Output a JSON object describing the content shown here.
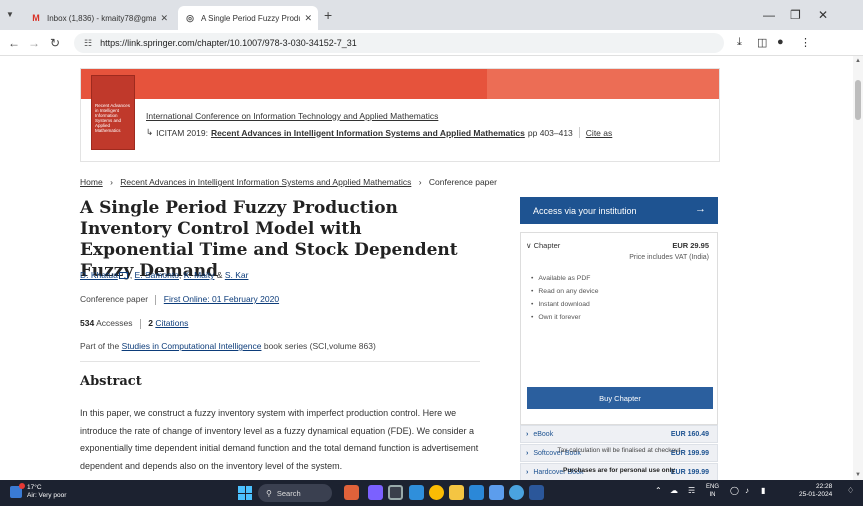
{
  "browser": {
    "tabs": [
      {
        "label": "Inbox (1,836) - kmaity78@gma...",
        "icon": "gmail-icon",
        "active": false
      },
      {
        "label": "A Single Period Fuzzy Productio",
        "icon": "springer-icon",
        "active": true
      }
    ],
    "url": "https://link.springer.com/chapter/10.1007/978-3-030-34152-7_31"
  },
  "banner": {
    "cover_text": "Recent Advances in Intelligent Information Systems and Applied Mathematics",
    "conference": "International Conference on Information Technology and Applied Mathematics",
    "proceedings_prefix": "ICITAM 2019:",
    "proceedings_title": "Recent Advances in Intelligent Information Systems and Applied Mathematics",
    "pages": "pp 403–413",
    "cite": "Cite as"
  },
  "breadcrumb": {
    "home": "Home",
    "book": "Recent Advances in Intelligent Information Systems and Applied Mathematics",
    "current": "Conference paper"
  },
  "article": {
    "title": "A Single Period Fuzzy Production Inventory Control Model with Exponential Time and Stock Dependent Fuzzy Demand",
    "authors": [
      "D. Khatua",
      "E. Samonto",
      "K. Maity",
      "S. Kar"
    ],
    "type": "Conference paper",
    "online": "First Online: 01 February 2020",
    "accesses_count": "534",
    "accesses_label": "Accesses",
    "citations_count": "2",
    "citations_label": "Citations",
    "series_prefix": "Part of the",
    "series_name": "Studies in Computational Intelligence",
    "series_suffix": "book series (SCI,volume 863)",
    "abstract_heading": "Abstract",
    "abstract_text": "In this paper, we construct a fuzzy inventory system with imperfect production control. Here we introduce the rate of change of inventory level as a fuzzy dynamical equation (FDE). We consider a exponentially time dependent initial demand function and the total demand function is advertisement dependent and depends also on the inventory level of the system."
  },
  "purchase": {
    "access_button": "Access via your institution",
    "chapter_label": "Chapter",
    "chapter_price": "EUR 29.95",
    "vat_note": "Price includes VAT (India)",
    "features": [
      "Available as PDF",
      "Read on any device",
      "Instant download",
      "Own it forever"
    ],
    "buy_button": "Buy Chapter",
    "formats": [
      {
        "name": "eBook",
        "price": "EUR 160.49"
      },
      {
        "name": "Softcover Book",
        "price": "EUR 199.99"
      },
      {
        "name": "Hardcover Book",
        "price": "EUR 199.99"
      }
    ],
    "tax_note": "Tax calculation will be finalised at checkout",
    "personal_note": "Purchases are for personal use only"
  },
  "taskbar": {
    "temperature": "17°C",
    "air_quality": "Air: Very poor",
    "search_label": "Search",
    "lang_top": "ENG",
    "lang_bottom": "IN",
    "time": "22:28",
    "date": "25-01-2024"
  }
}
